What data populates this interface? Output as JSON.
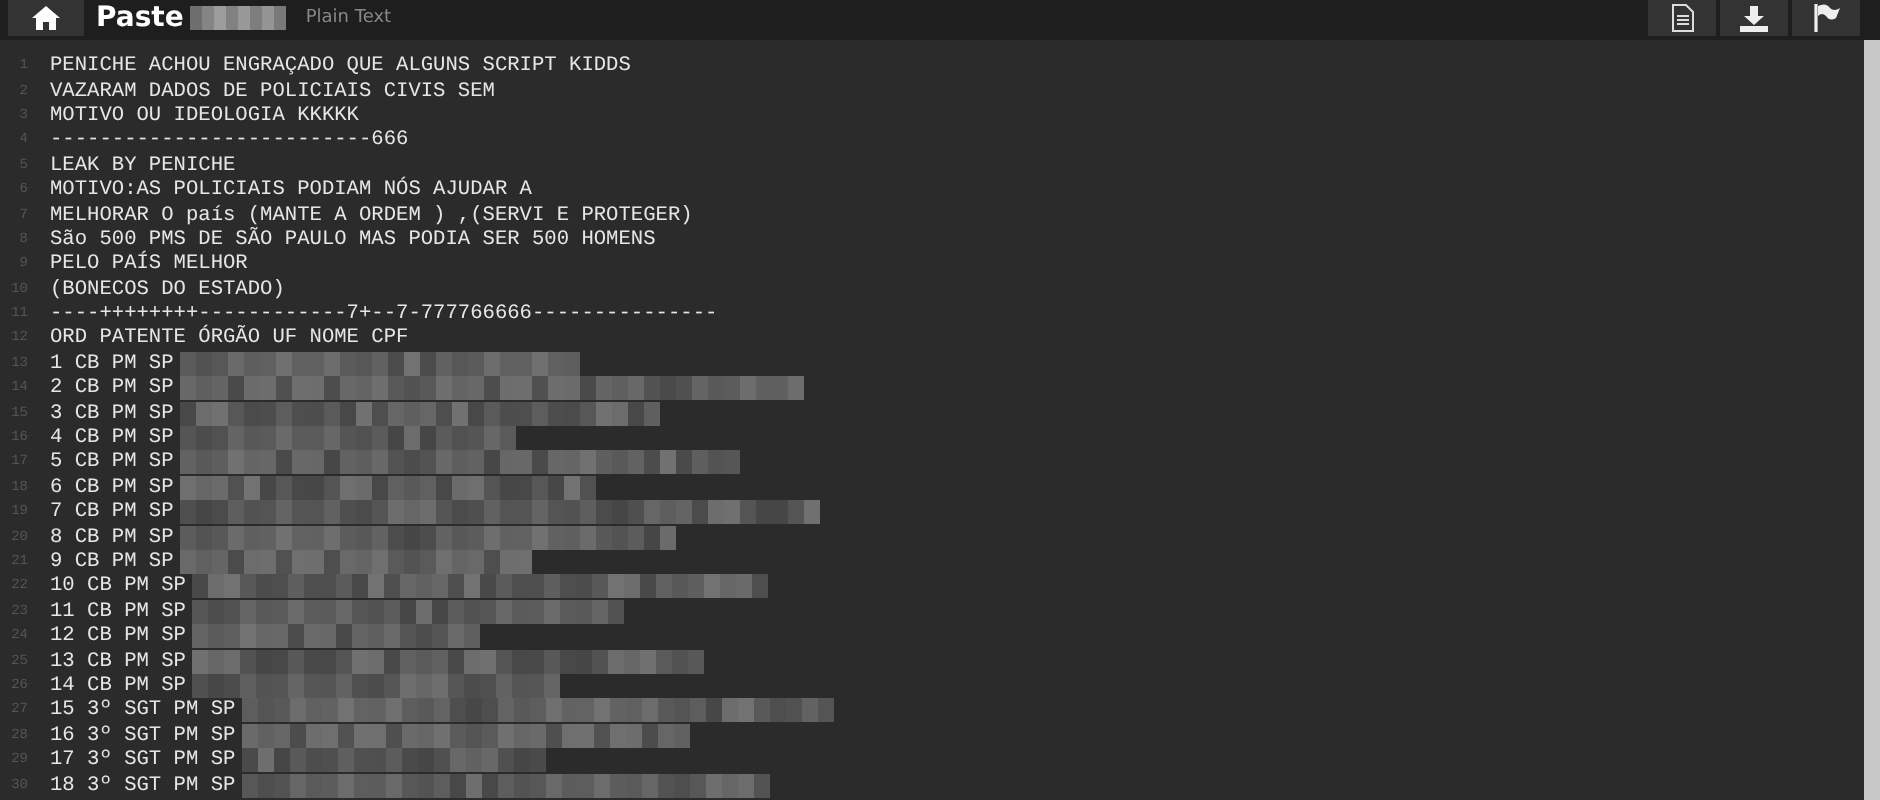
{
  "header": {
    "title": "Paste",
    "title_redacted": true,
    "syntax": "Plain Text"
  },
  "lines": [
    {
      "number": "1",
      "text": "PENICHE ACHOU ENGRAÇADO QUE ALGUNS SCRIPT KIDDS",
      "redacted": false
    },
    {
      "number": "2",
      "text": "VAZARAM DADOS DE POLICIAIS CIVIS SEM",
      "redacted": false
    },
    {
      "number": "3",
      "text": "MOTIVO OU IDEOLOGIA KKKKK",
      "redacted": false
    },
    {
      "number": "4",
      "text": "--------------------------666",
      "redacted": false
    },
    {
      "number": "5",
      "text": "LEAK BY PENICHE",
      "redacted": false
    },
    {
      "number": "6",
      "text": "MOTIVO:AS POLICIAIS PODIAM NÓS AJUDAR A",
      "redacted": false
    },
    {
      "number": "7",
      "text": "MELHORAR O país (MANTE A ORDEM ) ,(SERVI E PROTEGER)",
      "redacted": false
    },
    {
      "number": "8",
      "text": "São 500 PMS DE SÃO PAULO MAS PODIA SER 500 HOMENS",
      "redacted": false
    },
    {
      "number": "9",
      "text": "PELO PAÍS MELHOR",
      "redacted": false
    },
    {
      "number": "10",
      "text": "(BONECOS DO ESTADO)",
      "redacted": false
    },
    {
      "number": "11",
      "text": "----++++++++------------7+--7-777766666---------------",
      "redacted": false
    },
    {
      "number": "12",
      "text": "ORD PATENTE ÓRGÃO UF NOME CPF",
      "redacted": false
    },
    {
      "number": "13",
      "text": "1 CB PM SP",
      "redacted": true
    },
    {
      "number": "14",
      "text": "2 CB PM SP",
      "redacted": true
    },
    {
      "number": "15",
      "text": "3 CB PM SP",
      "redacted": true
    },
    {
      "number": "16",
      "text": "4 CB PM SP",
      "redacted": true
    },
    {
      "number": "17",
      "text": "5 CB PM SP",
      "redacted": true
    },
    {
      "number": "18",
      "text": "6 CB PM SP",
      "redacted": true
    },
    {
      "number": "19",
      "text": "7 CB PM SP",
      "redacted": true
    },
    {
      "number": "20",
      "text": "8 CB PM SP",
      "redacted": true
    },
    {
      "number": "21",
      "text": "9 CB PM SP",
      "redacted": true
    },
    {
      "number": "22",
      "text": "10 CB PM SP",
      "redacted": true
    },
    {
      "number": "23",
      "text": "11 CB PM SP",
      "redacted": true
    },
    {
      "number": "24",
      "text": "12 CB PM SP",
      "redacted": true
    },
    {
      "number": "25",
      "text": "13 CB PM SP",
      "redacted": true
    },
    {
      "number": "26",
      "text": "14 CB PM SP",
      "redacted": true
    },
    {
      "number": "27",
      "text": "15 3º SGT PM SP",
      "redacted": true
    },
    {
      "number": "28",
      "text": "16 3º SGT PM SP",
      "redacted": true
    },
    {
      "number": "29",
      "text": "17 3º SGT PM SP",
      "redacted": true
    },
    {
      "number": "30",
      "text": "18 3º SGT PM SP",
      "redacted": true
    }
  ]
}
